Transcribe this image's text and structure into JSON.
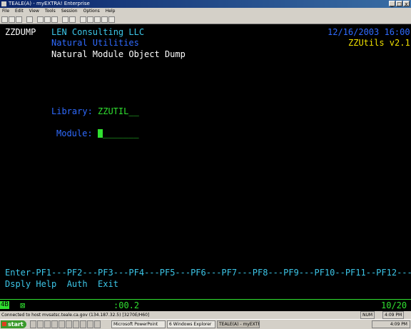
{
  "window": {
    "title": "TEALE(A) - myEXTRA! Enterprise",
    "controls": [
      "_",
      "□",
      "x"
    ]
  },
  "menu": [
    "File",
    "Edit",
    "View",
    "Tools",
    "Session",
    "Options",
    "Help"
  ],
  "toolbar": [
    "new",
    "open",
    "save",
    "print",
    "cut",
    "copy",
    "paste",
    "send",
    "receive",
    "settings",
    "keyboard",
    "colors",
    "macro",
    "help"
  ],
  "screen": {
    "program": "ZZDUMP",
    "company": "LEN Consulting LLC",
    "date_time": "12/16/2003 16:00",
    "subtitle": "Natural Utilities",
    "version": "ZZUtils v2.1",
    "heading": "Natural Module Object Dump",
    "library_label": "Library:",
    "library_value": "ZZUTIL__",
    "module_label": "Module:",
    "module_value": "_______",
    "pf_keys_line": "Enter-PF1---PF2---PF3---PF4---PF5---PF6---PF7---PF8---PF9---PF10--PF11--PF12---",
    "pf_labels_line": "Dsply Help  Auth  Exit"
  },
  "oia": {
    "indicator": "4B",
    "timer": ":00.2",
    "cursor_pos": "10/20",
    "cursor_glyph": "⊠"
  },
  "statusbar": {
    "connection": "Connected to host mvsatsc.teale.ca.gov (134.187.32.5) [3270E/H60]",
    "num": "NUM",
    "time": "4:09 PM"
  },
  "taskbar": {
    "start": "start",
    "tasks": [
      "Microsoft PowerPoint",
      "6 Windows Explorer",
      "TEALE(A) - myEXTRA!"
    ],
    "tray_time": "4:09 PM"
  }
}
